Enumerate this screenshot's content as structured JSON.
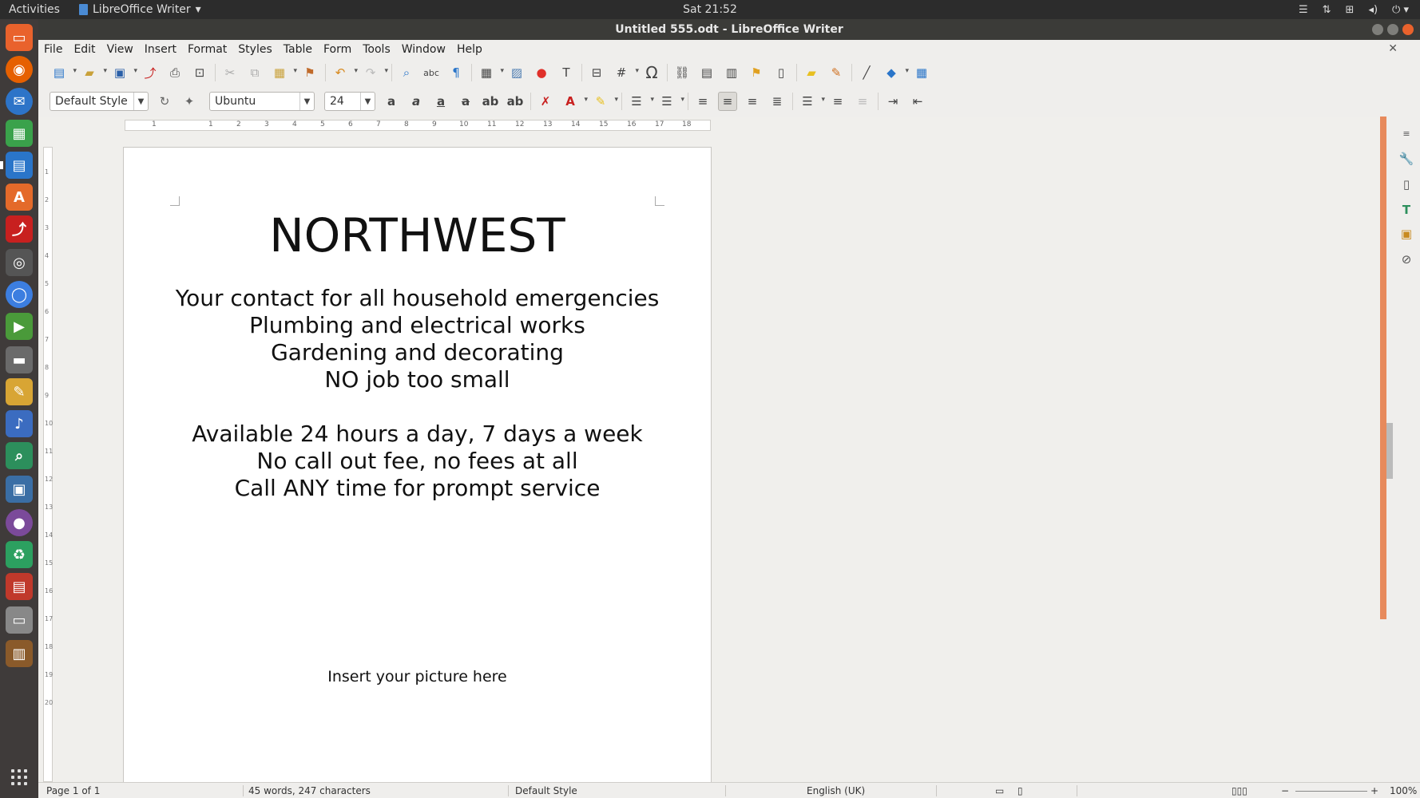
{
  "topbar": {
    "activities": "Activities",
    "app_name": "LibreOffice Writer",
    "clock": "Sat 21:52"
  },
  "window": {
    "title": "Untitled 555.odt - LibreOffice Writer"
  },
  "menu": {
    "items": [
      "File",
      "Edit",
      "View",
      "Insert",
      "Format",
      "Styles",
      "Table",
      "Form",
      "Tools",
      "Window",
      "Help"
    ]
  },
  "formatting": {
    "paragraph_style": "Default Style",
    "font_name": "Ubuntu",
    "font_size": "24"
  },
  "document": {
    "heading": "NORTHWEST",
    "lines_block1": [
      "Your contact for all household emergencies",
      "Plumbing and electrical works",
      "Gardening and decorating",
      "NO job too small"
    ],
    "lines_block2": [
      "Available 24 hours a day, 7 days a week",
      "No call out fee, no fees at all",
      "Call ANY time for prompt service"
    ],
    "picture_note": "Insert your picture here"
  },
  "statusbar": {
    "page": "Page 1 of 1",
    "word_count": "45 words, 247 characters",
    "page_style": "Default Style",
    "language": "English (UK)",
    "zoom": "100%"
  },
  "ruler": {
    "h_numbers": [
      "1",
      "1",
      "2",
      "3",
      "4",
      "5",
      "6",
      "7",
      "8",
      "9",
      "10",
      "11",
      "12",
      "13",
      "14",
      "15",
      "16",
      "17",
      "18"
    ],
    "v_numbers": [
      "1",
      "2",
      "3",
      "4",
      "5",
      "6",
      "7",
      "8",
      "9",
      "10",
      "11",
      "12",
      "13",
      "14",
      "15",
      "16",
      "17",
      "18",
      "19",
      "20"
    ]
  },
  "colors": {
    "accent": "#e78a5c",
    "topbar": "#2c2c2c",
    "launcher": "#3f3b3a"
  }
}
